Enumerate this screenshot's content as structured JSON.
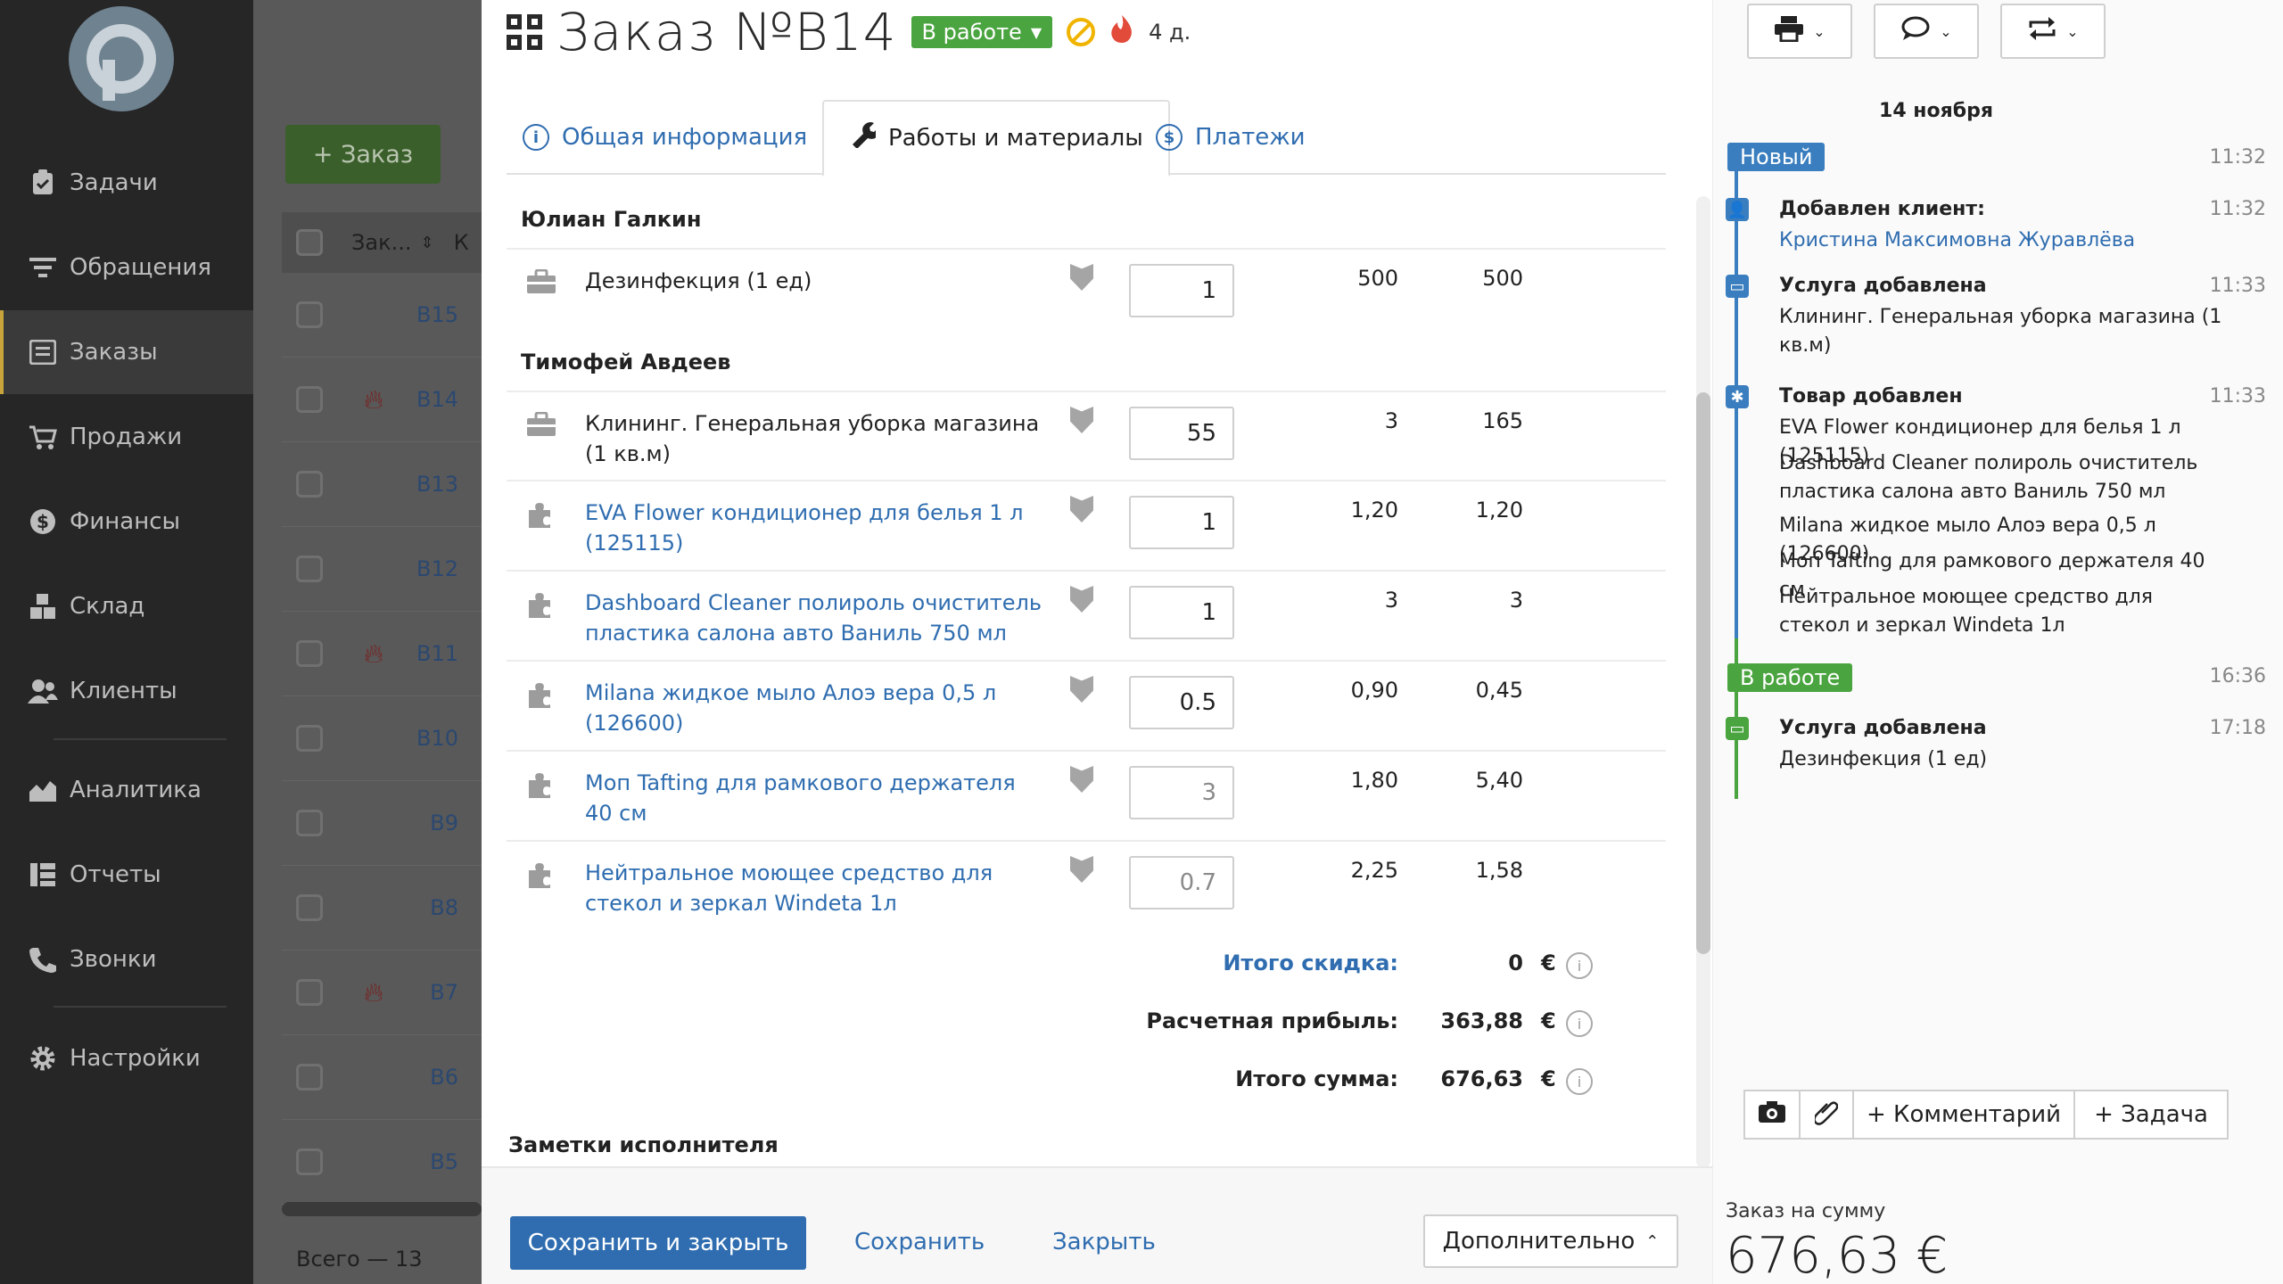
{
  "sidebar": {
    "items": [
      {
        "label": "Задачи",
        "icon": "clipboard-icon"
      },
      {
        "label": "Обращения",
        "icon": "filter-icon"
      },
      {
        "label": "Заказы",
        "icon": "orders-icon"
      },
      {
        "label": "Продажи",
        "icon": "cart-icon"
      },
      {
        "label": "Финансы",
        "icon": "dollar-icon"
      },
      {
        "label": "Склад",
        "icon": "boxes-icon"
      },
      {
        "label": "Клиенты",
        "icon": "users-icon"
      },
      {
        "label": "Аналитика",
        "icon": "chart-icon"
      },
      {
        "label": "Отчеты",
        "icon": "reports-icon"
      },
      {
        "label": "Звонки",
        "icon": "phone-icon"
      },
      {
        "label": "Настройки",
        "icon": "gear-icon"
      }
    ],
    "active": "Заказы"
  },
  "background_list": {
    "new_order_label": "+ Заказ",
    "column_order": "Зак...",
    "column_next": "К",
    "rows": [
      {
        "id": "B15",
        "fire": false
      },
      {
        "id": "B14",
        "fire": true
      },
      {
        "id": "B13",
        "fire": false
      },
      {
        "id": "B12",
        "fire": false
      },
      {
        "id": "B11",
        "fire": true
      },
      {
        "id": "B10",
        "fire": false
      },
      {
        "id": "B9",
        "fire": false
      },
      {
        "id": "B8",
        "fire": false
      },
      {
        "id": "B7",
        "fire": true
      },
      {
        "id": "B6",
        "fire": false
      },
      {
        "id": "B5",
        "fire": false
      }
    ],
    "total": "Всего — 13"
  },
  "header": {
    "title": "Заказ №B14",
    "status": "В работе",
    "status_color": "#4aa43f",
    "days": "4 д."
  },
  "tabs": [
    {
      "label": "Общая информация",
      "icon": "info-icon"
    },
    {
      "label": "Работы и материалы",
      "icon": "wrench-icon"
    },
    {
      "label": "Платежи",
      "icon": "dollar-icon"
    }
  ],
  "groups": [
    {
      "name": "Юлиан Галкин",
      "rows": [
        {
          "name": "Дезинфекция (1 ед)",
          "type": "service",
          "qty": "1",
          "price": "500",
          "sum": "500"
        }
      ]
    },
    {
      "name": "Тимофей Авдеев",
      "rows": [
        {
          "name": "Клининг. Генеральная уборка магазина (1 кв.м)",
          "type": "service",
          "qty": "55",
          "price": "3",
          "sum": "165"
        },
        {
          "name": "EVA Flower кондиционер для белья 1 л (125115)",
          "type": "product",
          "qty": "1",
          "price": "1,20",
          "sum": "1,20"
        },
        {
          "name": "Dashboard Cleaner полироль очиститель пластика салона авто Ваниль 750 мл",
          "type": "product",
          "qty": "1",
          "price": "3",
          "sum": "3"
        },
        {
          "name": "Milana жидкое мыло Алоэ вера 0,5 л (126600)",
          "type": "product",
          "qty": "0.5",
          "price": "0,90",
          "sum": "0,45"
        },
        {
          "name": "Моп Tafting для рамкового держателя 40 см",
          "type": "product",
          "qty": "3",
          "price": "1,80",
          "sum": "5,40"
        },
        {
          "name": "Нейтральное моющее средство для стекол и зеркал Windeta 1л",
          "type": "product",
          "qty": "0.7",
          "price": "2,25",
          "sum": "1,58"
        }
      ]
    }
  ],
  "totals": {
    "discount_label": "Итого скидка:",
    "discount": "0",
    "profit_label": "Расчетная прибыль:",
    "profit": "363,88",
    "total_label": "Итого сумма:",
    "total": "676,63",
    "currency": "€"
  },
  "notes_title": "Заметки исполнителя",
  "footer": {
    "save_close": "Сохранить и закрыть",
    "save": "Сохранить",
    "close": "Закрыть",
    "more": "Дополнительно"
  },
  "timeline": {
    "date": "14 ноября",
    "status_new": "Новый",
    "status_new_time": "11:32",
    "client_title": "Добавлен клиент:",
    "client_time": "11:32",
    "client_name": "Кристина Максимовна Журавлёва",
    "service_title": "Услуга добавлена",
    "service_time": "11:33",
    "service_text": "Клининг. Генеральная уборка магазина (1 кв.м)",
    "product_title": "Товар добавлен",
    "product_time": "11:33",
    "products": [
      "EVA Flower кондиционер для белья 1 л (125115)",
      "Dashboard Cleaner полироль очиститель пластика салона авто Ваниль 750 мл",
      "Milana жидкое мыло Алоэ вера 0,5 л (126600)",
      "Моп Tafting для рамкового держателя 40 см",
      "Нейтральное моющее средство для стекол и зеркал Windeta 1л"
    ],
    "status_work": "В работе",
    "status_work_time": "16:36",
    "service2_title": "Услуга добавлена",
    "service2_time": "17:18",
    "service2_text": "Дезинфекция (1 ед)",
    "color_new": "#3a7ebf",
    "color_work": "#4aa43f"
  },
  "right_actions": {
    "comment": "+ Комментарий",
    "task": "+ Задача"
  },
  "order_sum": {
    "label": "Заказ на сумму",
    "value": "676,63 €"
  }
}
